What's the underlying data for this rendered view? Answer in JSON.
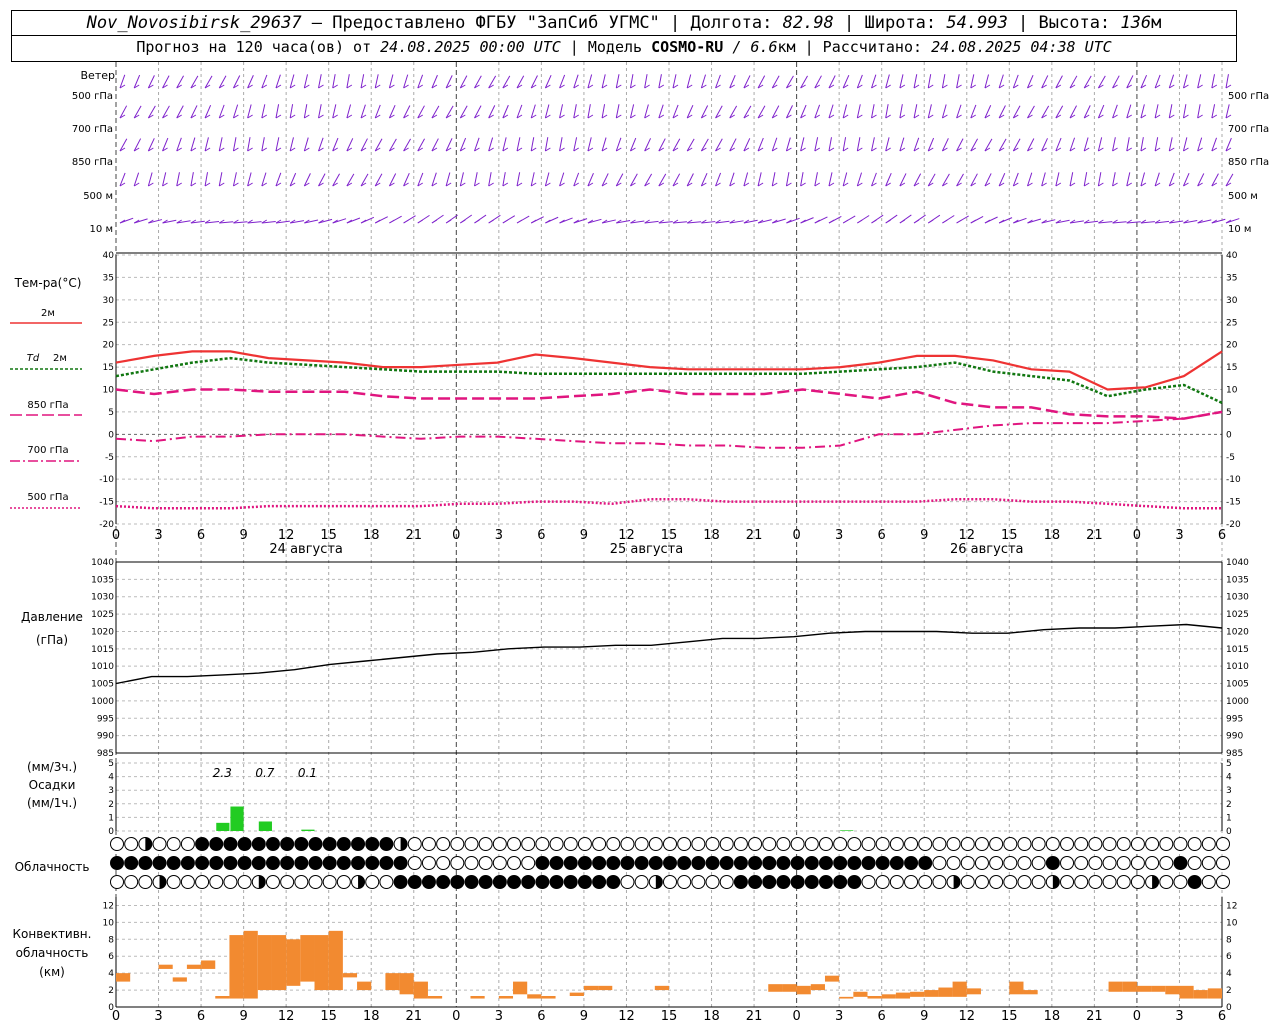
{
  "header": {
    "station": "Nov_Novosibirsk_29637",
    "provided_by": " — Предоставлено ФГБУ \"ЗапСиб УГМС\" | Долгота: ",
    "lon": "82.98",
    "lat_label": " | Широта: ",
    "lat": "54.993",
    "alt_label": " | Высота: ",
    "alt": "136",
    "alt_unit": "м",
    "forecast_label": "Прогноз на 120 часа(ов) от ",
    "forecast_start": "24.08.2025 00:00 UTC",
    "model_label": " | Модель ",
    "model": "COSMO-RU",
    "model_res": " / 6.6",
    "model_res_unit": "км",
    "calc_label": " | Рассчитано: ",
    "calc_time": "24.08.2025 04:38 UTC"
  },
  "x_axis": {
    "hour_labels": [
      "0",
      "3",
      "6",
      "9",
      "12",
      "15",
      "18",
      "21",
      "0",
      "3",
      "6",
      "9",
      "12",
      "15",
      "18",
      "21",
      "0",
      "3",
      "6",
      "9",
      "12",
      "15",
      "18",
      "21",
      "0",
      "3",
      "6"
    ],
    "day_labels": [
      "24 августа",
      "25 августа",
      "26 августа"
    ]
  },
  "wind": {
    "title": "Ветер",
    "levels": [
      "500 гПа",
      "700 гПа",
      "850 гПа",
      "500 м",
      "10 м"
    ],
    "right_levels": [
      "500 гПа",
      "700 гПа",
      "850 гПа",
      "500 м",
      "10 м"
    ]
  },
  "labels": {
    "temp_title": "Тем-ра(°С)",
    "temp_2m": "2м",
    "td": "Td",
    "td_2m": "2м",
    "t850": "850 гПа",
    "t700": "700 гПа",
    "t500": "500 гПа",
    "pressure_title": "Давление",
    "pressure_unit": "(гПа)",
    "precip_unit3": "(мм/3ч.)",
    "precip_title": "Осадки",
    "precip_unit1": "(мм/1ч.)",
    "cloud_title": "Облачность",
    "conv1": "Конвективн.",
    "conv2": "облачность",
    "conv3": "(км)"
  },
  "colors": {
    "t2m": "#ee3333",
    "td": "#117711",
    "levels": "#e0157f",
    "wind": "#7f22cc",
    "precip": "#22cc22",
    "conv": "#f28a30"
  },
  "chart_data": [
    {
      "type": "line",
      "title": "Тем-ра(°С)",
      "x_hours": [
        0,
        6,
        12,
        18,
        24,
        30,
        36,
        42,
        48,
        54,
        60,
        66,
        72,
        78,
        84,
        90,
        96,
        102,
        108,
        114,
        120
      ],
      "ylim": [
        -20,
        40
      ],
      "series": [
        {
          "name": "2м",
          "values": [
            16,
            17.5,
            18.5,
            18.5,
            17,
            16.5,
            16,
            15,
            15,
            15.5,
            16,
            17.8,
            17,
            16,
            15,
            14.5,
            14.5,
            14.5,
            14.5,
            15,
            16,
            17.5,
            17.5,
            16.5,
            14.5,
            14,
            10,
            10.5,
            13,
            18.5
          ]
        },
        {
          "name": "Td 2м",
          "values": [
            13,
            14.5,
            16,
            17,
            16,
            15.5,
            15,
            14.5,
            14,
            14,
            14,
            13.5,
            13.5,
            13.5,
            13.5,
            13.5,
            13.5,
            13.5,
            13.5,
            14,
            14.5,
            15,
            16,
            14,
            13,
            12,
            8.5,
            10,
            11,
            7
          ]
        },
        {
          "name": "850 гПа",
          "values": [
            10,
            9,
            10,
            10,
            9.5,
            9.5,
            9.5,
            8.5,
            8,
            8,
            8,
            8,
            8.5,
            9,
            10,
            9,
            9,
            9,
            10,
            9,
            8,
            9.5,
            7,
            6,
            6,
            4.5,
            4,
            4,
            3.5,
            5
          ]
        },
        {
          "name": "700 гПа",
          "values": [
            -1,
            -1.5,
            -0.5,
            -0.5,
            0,
            0,
            0,
            -0.5,
            -1,
            -0.5,
            -0.5,
            -1,
            -1.5,
            -2,
            -2,
            -2.5,
            -2.5,
            -3,
            -3,
            -2.5,
            0,
            0,
            1,
            2,
            2.5,
            2.5,
            2.5,
            3,
            3.5,
            5
          ]
        },
        {
          "name": "500 гПа",
          "values": [
            -16,
            -16.5,
            -16.5,
            -16.5,
            -16,
            -16,
            -16,
            -16,
            -16,
            -15.5,
            -15.5,
            -15,
            -15,
            -15.5,
            -14.5,
            -14.5,
            -15,
            -15,
            -15,
            -15,
            -15,
            -15,
            -14.5,
            -14.5,
            -15,
            -15,
            -15.5,
            -16,
            -16.5,
            -16.5
          ]
        }
      ]
    },
    {
      "type": "line",
      "title": "Давление",
      "ylabel": "(гПа)",
      "ylim": [
        985,
        1040
      ],
      "series": [
        {
          "name": "Давление",
          "values": [
            1005,
            1007,
            1007,
            1007.5,
            1008,
            1009,
            1010.5,
            1011.5,
            1012.5,
            1013.5,
            1014,
            1015,
            1015.5,
            1015.5,
            1016,
            1016,
            1017,
            1018,
            1018,
            1018.5,
            1019.5,
            1020,
            1020,
            1020,
            1019.5,
            1019.5,
            1020.5,
            1021,
            1021,
            1021.5,
            1022,
            1021
          ]
        }
      ]
    },
    {
      "type": "bar",
      "title": "Осадки",
      "ylim": [
        0,
        5
      ],
      "hourly_mm": [
        {
          "h": 7,
          "v": 0.6
        },
        {
          "h": 8,
          "v": 1.8
        },
        {
          "h": 10,
          "v": 0.7
        },
        {
          "h": 13,
          "v": 0.1
        },
        {
          "h": 51,
          "v": 0.05
        }
      ],
      "three_hour_mm": [
        {
          "h": 7.5,
          "label": "2.3"
        },
        {
          "h": 10.5,
          "label": "0.7"
        },
        {
          "h": 13.5,
          "label": "0.1"
        }
      ]
    },
    {
      "type": "bar",
      "title": "Конвективн. облачность",
      "ylabel": "(км)",
      "ylim": [
        0,
        12
      ],
      "segments": [
        {
          "h": 0,
          "b": 3,
          "t": 4
        },
        {
          "h": 3,
          "b": 4.5,
          "t": 5
        },
        {
          "h": 4,
          "b": 3,
          "t": 3.5
        },
        {
          "h": 5,
          "b": 4.5,
          "t": 5
        },
        {
          "h": 6,
          "b": 4.5,
          "t": 5.5
        },
        {
          "h": 7,
          "b": 1,
          "t": 1.3
        },
        {
          "h": 8,
          "b": 1,
          "t": 8.5
        },
        {
          "h": 9,
          "b": 1,
          "t": 9
        },
        {
          "h": 10,
          "b": 2,
          "t": 8.5
        },
        {
          "h": 11,
          "b": 2,
          "t": 8.5
        },
        {
          "h": 12,
          "b": 2.5,
          "t": 8
        },
        {
          "h": 13,
          "b": 3,
          "t": 8.5
        },
        {
          "h": 14,
          "b": 2,
          "t": 8.5
        },
        {
          "h": 15,
          "b": 2,
          "t": 9
        },
        {
          "h": 16,
          "b": 3.5,
          "t": 4
        },
        {
          "h": 17,
          "b": 2,
          "t": 3
        },
        {
          "h": 19,
          "b": 2,
          "t": 4
        },
        {
          "h": 20,
          "b": 1.5,
          "t": 4
        },
        {
          "h": 21,
          "b": 1,
          "t": 3
        },
        {
          "h": 22,
          "b": 1,
          "t": 1.3
        },
        {
          "h": 25,
          "b": 1,
          "t": 1.3
        },
        {
          "h": 27,
          "b": 1,
          "t": 1.3
        },
        {
          "h": 28,
          "b": 1.5,
          "t": 3
        },
        {
          "h": 29,
          "b": 1,
          "t": 1.5
        },
        {
          "h": 30,
          "b": 1,
          "t": 1.3
        },
        {
          "h": 32,
          "b": 1.3,
          "t": 1.7
        },
        {
          "h": 33,
          "b": 2,
          "t": 2.5
        },
        {
          "h": 34,
          "b": 2,
          "t": 2.5
        },
        {
          "h": 38,
          "b": 2,
          "t": 2.5
        },
        {
          "h": 46,
          "b": 1.8,
          "t": 2.7
        },
        {
          "h": 47,
          "b": 1.8,
          "t": 2.7
        },
        {
          "h": 48,
          "b": 1.5,
          "t": 2.5
        },
        {
          "h": 49,
          "b": 2,
          "t": 2.7
        },
        {
          "h": 50,
          "b": 3,
          "t": 3.7
        },
        {
          "h": 51,
          "b": 1,
          "t": 1.2
        },
        {
          "h": 52,
          "b": 1.2,
          "t": 1.8
        },
        {
          "h": 53,
          "b": 1,
          "t": 1.3
        },
        {
          "h": 54,
          "b": 1,
          "t": 1.5
        },
        {
          "h": 55,
          "b": 1,
          "t": 1.7
        },
        {
          "h": 56,
          "b": 1.2,
          "t": 1.8
        },
        {
          "h": 57,
          "b": 1.2,
          "t": 2
        },
        {
          "h": 58,
          "b": 1.2,
          "t": 2.3
        },
        {
          "h": 59,
          "b": 1.2,
          "t": 3
        },
        {
          "h": 60,
          "b": 1.5,
          "t": 2.2
        },
        {
          "h": 63,
          "b": 1.5,
          "t": 3
        },
        {
          "h": 64,
          "b": 1.5,
          "t": 2
        },
        {
          "h": 70,
          "b": 1.8,
          "t": 3
        },
        {
          "h": 71,
          "b": 1.8,
          "t": 3
        },
        {
          "h": 72,
          "b": 1.8,
          "t": 2.5
        },
        {
          "h": 73,
          "b": 1.8,
          "t": 2.5
        },
        {
          "h": 74,
          "b": 1.5,
          "t": 2.5
        },
        {
          "h": 75,
          "b": 1,
          "t": 2.5
        },
        {
          "h": 76,
          "b": 1,
          "t": 2
        },
        {
          "h": 77,
          "b": 1,
          "t": 2.2
        }
      ]
    }
  ]
}
